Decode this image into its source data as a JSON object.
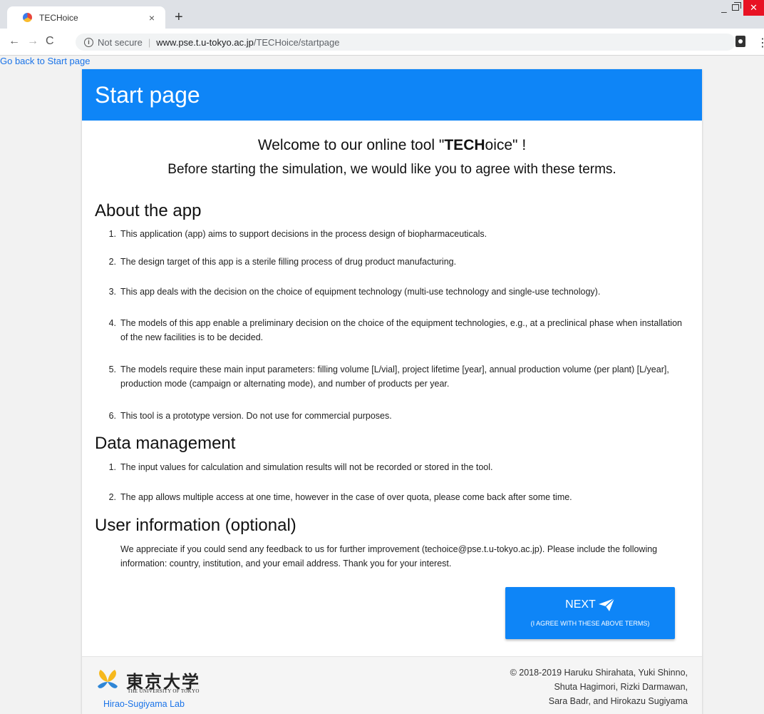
{
  "browser": {
    "tab_title": "TECHoice",
    "tab_close": "×",
    "new_tab": "+",
    "security_label": "Not secure",
    "url_host": "www.pse.t.u-tokyo.ac.jp",
    "url_path": "/TECHoice/startpage",
    "icons": [
      "back-arrow-icon",
      "forward-arrow-icon",
      "reload-icon",
      "info-icon",
      "extension-icon",
      "menu-dots-icon"
    ]
  },
  "back_link": "Go back to Start page",
  "header": {
    "title": "Start page"
  },
  "welcome": {
    "prefix": "Welcome to our online tool \"",
    "bold": "TECH",
    "suffix": "oice\" !",
    "terms_line": "Before starting the simulation, we would like you to agree with these terms."
  },
  "about": {
    "title": "About the app",
    "items": [
      "This application (app) aims to support decisions in the process design of biopharmaceuticals.",
      "The design target of this app is a sterile filling process of drug product manufacturing.",
      "This app deals with the decision on the choice of equipment technology (multi-use technology and single-use technology).",
      "The models of this app enable a preliminary decision on the choice of the equipment technologies, e.g., at a preclinical phase when installation of the new facilities is to be decided.",
      "The models require these main input parameters: filling volume [L/vial], project lifetime [year], annual production volume (per plant) [L/year], production mode (campaign or alternating mode), and number of products per year.",
      "This tool is a prototype version. Do not use for commercial purposes."
    ]
  },
  "data_management": {
    "title": "Data management",
    "items": [
      "The input values for calculation and simulation results will not be recorded or stored in the tool.",
      "The app allows multiple access at one time, however in the case of over quota, please come back after some time."
    ]
  },
  "user_info": {
    "title": "User information (optional)",
    "text": "We appreciate if you could send any feedback to us for further improvement (techoice@pse.t.u-tokyo.ac.jp). Please include the following information: country, institution, and your email address. Thank you for your interest."
  },
  "next_button": {
    "label": "NEXT",
    "sub": "(I AGREE WITH THESE ABOVE TERMS)"
  },
  "footer": {
    "logo_kanji": "東京大学",
    "logo_english": "THE UNIVERSITY OF TOKYO",
    "lab": "Hirao-Sugiyama Lab",
    "copyright_lines": [
      "© 2018-2019 Haruku Shirahata, Yuki Shinno,",
      "Shuta Hagimori, Rizki Darmawan,",
      "Sara Badr, and Hirokazu Sugiyama"
    ]
  },
  "colors": {
    "primary": "#0e85f7",
    "link": "#1a73e8",
    "close_button": "#e81123"
  }
}
